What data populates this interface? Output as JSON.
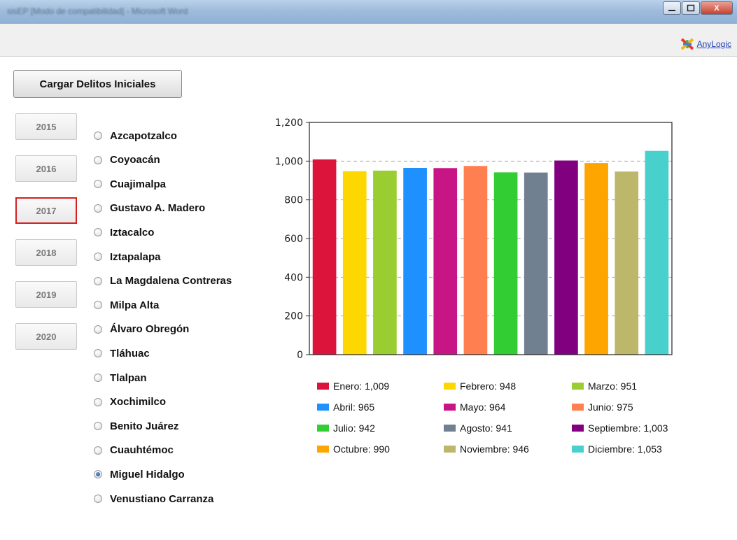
{
  "titlebar": {
    "title": "sisEP [Modo de compatibilidad] - Microsoft Word",
    "minimize_icon": "minimize-icon",
    "maximize_icon": "restore-icon",
    "close_label": "X"
  },
  "toolbar": {
    "anylogic_label": "AnyLogic",
    "anylogic_icon": "anylogic-logo-icon"
  },
  "load_button": {
    "label": "Cargar Delitos Iniciales"
  },
  "years": [
    "2015",
    "2016",
    "2017",
    "2018",
    "2019",
    "2020"
  ],
  "selected_year": "2017",
  "districts": [
    "Azcapotzalco",
    "Coyoacán",
    "Cuajimalpa",
    "Gustavo A. Madero",
    "Iztacalco",
    "Iztapalapa",
    "La Magdalena Contreras",
    "Milpa Alta",
    "Álvaro Obregón",
    "Tláhuac",
    "Tlalpan",
    "Xochimilco",
    "Benito Juárez",
    "Cuauhtémoc",
    "Miguel Hidalgo",
    "Venustiano Carranza"
  ],
  "selected_district": "Miguel Hidalgo",
  "chart_data": {
    "type": "bar",
    "categories": [
      "Enero",
      "Febrero",
      "Marzo",
      "Abril",
      "Mayo",
      "Junio",
      "Julio",
      "Agosto",
      "Septiembre",
      "Octubre",
      "Noviembre",
      "Diciembre"
    ],
    "values": [
      1009,
      948,
      951,
      965,
      964,
      975,
      942,
      941,
      1003,
      990,
      946,
      1053
    ],
    "colors": [
      "#dc143c",
      "#ffd700",
      "#9acd32",
      "#1e90ff",
      "#c71585",
      "#ff7f50",
      "#32cd32",
      "#708090",
      "#800080",
      "#ffa500",
      "#bdb76b",
      "#48d1cc"
    ],
    "legend": [
      "Enero: 1,009",
      "Febrero: 948",
      "Marzo: 951",
      "Abril: 965",
      "Mayo: 964",
      "Junio: 975",
      "Julio: 942",
      "Agosto: 941",
      "Septiembre: 1,003",
      "Octubre: 990",
      "Noviembre: 946",
      "Diciembre: 1,053"
    ],
    "y_ticks": [
      "0",
      "200",
      "400",
      "600",
      "800",
      "1,000",
      "1,200"
    ],
    "ylim": [
      0,
      1200
    ],
    "grid": "horizontal dashed",
    "legend_placement": "bottom"
  }
}
